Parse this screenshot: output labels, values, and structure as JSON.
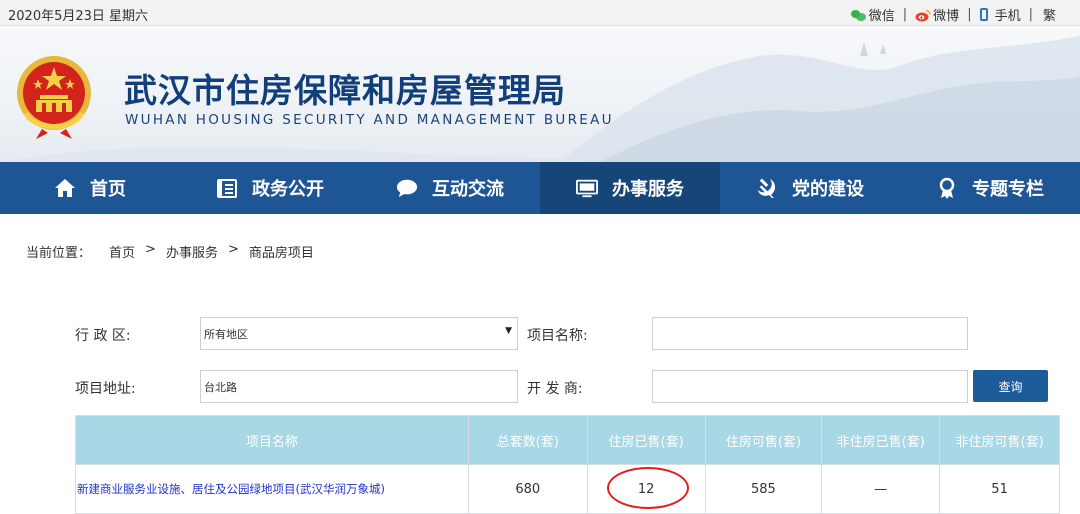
{
  "topbar": {
    "date": "2020年5月23日 星期六",
    "links": [
      {
        "icon": "wechat-icon",
        "label": "微信"
      },
      {
        "icon": "weibo-icon",
        "label": "微博"
      },
      {
        "icon": "phone-icon",
        "label": "手机"
      },
      {
        "icon": "",
        "label": "繁"
      }
    ]
  },
  "header": {
    "title_cn": "武汉市住房保障和房屋管理局",
    "title_en": "WUHAN HOUSING SECURITY AND MANAGEMENT BUREAU"
  },
  "nav": {
    "items": [
      {
        "label": "首页",
        "icon": "home-icon"
      },
      {
        "label": "政务公开",
        "icon": "document-icon"
      },
      {
        "label": "互动交流",
        "icon": "chat-bubble-icon"
      },
      {
        "label": "办事服务",
        "icon": "monitor-icon",
        "active": true
      },
      {
        "label": "党的建设",
        "icon": "hammer-sickle-icon"
      },
      {
        "label": "专题专栏",
        "icon": "award-ribbon-icon"
      }
    ]
  },
  "breadcrumb": {
    "prefix": "当前位置：",
    "items": [
      "首页",
      "办事服务",
      "商品房项目"
    ],
    "separator": ">"
  },
  "search": {
    "district_label": "行 政 区:",
    "district_value": "所有地区",
    "project_name_label": "项目名称:",
    "project_name_value": "",
    "address_label": "项目地址:",
    "address_value": "台北路",
    "developer_label": "开 发 商:",
    "developer_value": "",
    "query_button": "查询"
  },
  "table": {
    "headers": [
      "项目名称",
      "总套数(套)",
      "住房已售(套)",
      "住房可售(套)",
      "非住房已售(套)",
      "非住房可售(套)"
    ],
    "rows": [
      [
        "新建商业服务业设施、居住及公园绿地项目(武汉华润万象城)",
        "680",
        "12",
        "585",
        "—",
        "51"
      ]
    ]
  },
  "colors": {
    "nav_bg": "#1e5595",
    "nav_active": "#164577",
    "title": "#123f7a",
    "table_header": "#a8d7e5",
    "link": "#2233cc",
    "highlight_circle": "#e02020"
  }
}
